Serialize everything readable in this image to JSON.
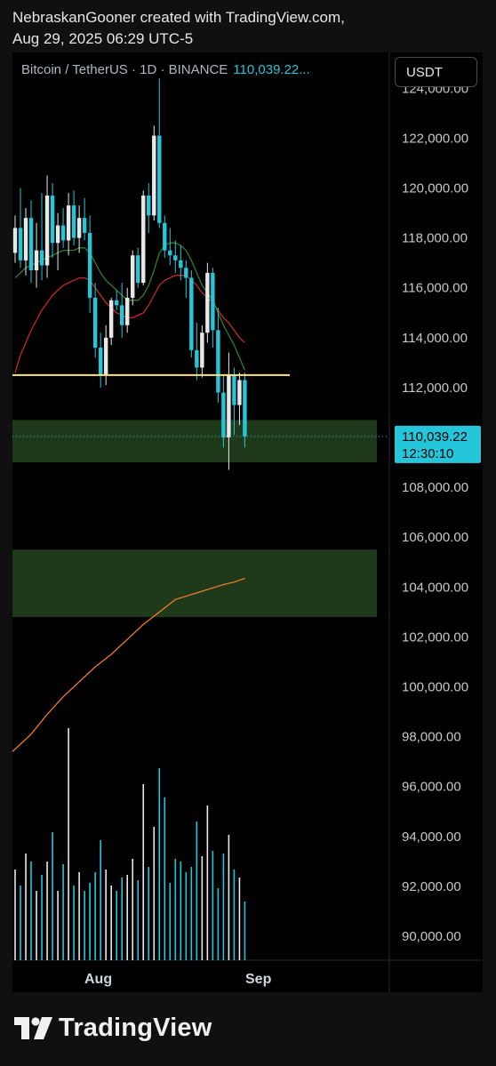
{
  "header": {
    "line1": "NebraskanGooner created with TradingView.com,",
    "line2": "Aug 29, 2025 06:29 UTC-5"
  },
  "legend": {
    "symbol": "Bitcoin / TetherUS · 1D · BINANCE",
    "price": "110,039.22..."
  },
  "currency_button": "USDT",
  "price_tag": {
    "price": "110,039.22",
    "countdown": "12:30:10"
  },
  "footer": {
    "brand": "TradingView"
  },
  "colors": {
    "up": "#e8e8e8",
    "down": "#26c6da",
    "ma_short": "#2e7d32",
    "ma_mid": "#c62828",
    "ma_long": "#ef7a28",
    "support_line": "#ffe47a",
    "zone": "#1f3a1b",
    "accent": "#26c6da"
  },
  "chart_data": {
    "type": "candlestick",
    "y_axis": {
      "ticks": [
        "122,000.00",
        "120,000.00",
        "118,000.00",
        "116,000.00",
        "114,000.00",
        "112,000.00",
        "108,000.00",
        "106,000.00",
        "104,000.00",
        "102,000.00",
        "100,000.00",
        "98,000.00",
        "96,000.00",
        "94,000.00",
        "92,000.00",
        "90,000.00"
      ],
      "partial_top_tick": "124,000.00",
      "range": [
        89200,
        124500
      ]
    },
    "x_axis": {
      "labels": [
        "Aug",
        "Sep"
      ]
    },
    "last_price": 110039.22,
    "support_line": 112500,
    "zones": [
      {
        "low": 109000,
        "high": 110700
      },
      {
        "low": 102800,
        "high": 105500
      }
    ],
    "candles": [
      {
        "o": 117400,
        "h": 118900,
        "l": 117000,
        "c": 118400
      },
      {
        "o": 118400,
        "h": 120000,
        "l": 116800,
        "c": 117100
      },
      {
        "o": 117100,
        "h": 119200,
        "l": 116500,
        "c": 118800
      },
      {
        "o": 118800,
        "h": 119500,
        "l": 116200,
        "c": 116700
      },
      {
        "o": 116700,
        "h": 118600,
        "l": 116000,
        "c": 117500
      },
      {
        "o": 117500,
        "h": 119800,
        "l": 116300,
        "c": 116900
      },
      {
        "o": 116900,
        "h": 120500,
        "l": 116400,
        "c": 119700
      },
      {
        "o": 119700,
        "h": 120200,
        "l": 117200,
        "c": 117800
      },
      {
        "o": 117800,
        "h": 119000,
        "l": 116700,
        "c": 118500
      },
      {
        "o": 118500,
        "h": 119200,
        "l": 117600,
        "c": 117900
      },
      {
        "o": 117900,
        "h": 119800,
        "l": 117300,
        "c": 119300
      },
      {
        "o": 119300,
        "h": 119900,
        "l": 117700,
        "c": 118000
      },
      {
        "o": 118000,
        "h": 119300,
        "l": 117400,
        "c": 118800
      },
      {
        "o": 118800,
        "h": 119600,
        "l": 117900,
        "c": 118200
      },
      {
        "o": 118200,
        "h": 118900,
        "l": 115000,
        "c": 115600
      },
      {
        "o": 115600,
        "h": 116200,
        "l": 113200,
        "c": 113600
      },
      {
        "o": 113600,
        "h": 114200,
        "l": 112000,
        "c": 112500
      },
      {
        "o": 112500,
        "h": 114500,
        "l": 112100,
        "c": 114000
      },
      {
        "o": 114000,
        "h": 115600,
        "l": 113700,
        "c": 115500
      },
      {
        "o": 115500,
        "h": 115900,
        "l": 115100,
        "c": 115300
      },
      {
        "o": 115300,
        "h": 116200,
        "l": 114000,
        "c": 114500
      },
      {
        "o": 114500,
        "h": 116000,
        "l": 114200,
        "c": 115600
      },
      {
        "o": 115600,
        "h": 117500,
        "l": 115300,
        "c": 117300
      },
      {
        "o": 117300,
        "h": 117600,
        "l": 116000,
        "c": 116200
      },
      {
        "o": 116200,
        "h": 119900,
        "l": 116100,
        "c": 119700
      },
      {
        "o": 119700,
        "h": 120200,
        "l": 118200,
        "c": 118900
      },
      {
        "o": 118900,
        "h": 122500,
        "l": 118700,
        "c": 122100
      },
      {
        "o": 122100,
        "h": 124400,
        "l": 118400,
        "c": 118600
      },
      {
        "o": 118600,
        "h": 118900,
        "l": 117200,
        "c": 117500
      },
      {
        "o": 117500,
        "h": 118400,
        "l": 116900,
        "c": 117300
      },
      {
        "o": 117300,
        "h": 117900,
        "l": 116600,
        "c": 117100
      },
      {
        "o": 117100,
        "h": 117700,
        "l": 116300,
        "c": 116800
      },
      {
        "o": 116800,
        "h": 117100,
        "l": 115600,
        "c": 116400
      },
      {
        "o": 116400,
        "h": 116700,
        "l": 113200,
        "c": 113500
      },
      {
        "o": 113500,
        "h": 114600,
        "l": 112300,
        "c": 112800
      },
      {
        "o": 112800,
        "h": 114500,
        "l": 112400,
        "c": 114200
      },
      {
        "o": 114200,
        "h": 117000,
        "l": 113800,
        "c": 116600
      },
      {
        "o": 116600,
        "h": 116800,
        "l": 113600,
        "c": 114300
      },
      {
        "o": 114300,
        "h": 115200,
        "l": 111400,
        "c": 111800
      },
      {
        "o": 111800,
        "h": 112500,
        "l": 109600,
        "c": 110000
      },
      {
        "o": 110000,
        "h": 113400,
        "l": 108700,
        "c": 112500
      },
      {
        "o": 112500,
        "h": 112800,
        "l": 110100,
        "c": 111300
      },
      {
        "o": 111300,
        "h": 112600,
        "l": 110500,
        "c": 112300
      },
      {
        "o": 112300,
        "h": 112600,
        "l": 109600,
        "c": 110039
      }
    ],
    "ma_short": [
      116400,
      116600,
      116800,
      116900,
      117000,
      117100,
      117200,
      117300,
      117400,
      117500,
      117500,
      117500,
      117600,
      117600,
      117400,
      117000,
      116600,
      116300,
      116100,
      115900,
      115700,
      115500,
      115500,
      115500,
      115700,
      116100,
      116700,
      117400,
      117700,
      117800,
      117800,
      117700,
      117500,
      117100,
      116600,
      116100,
      115800,
      115500,
      115000,
      114500,
      114100,
      113700,
      113200,
      112700
    ],
    "ma_mid": [
      112600,
      113300,
      113800,
      114300,
      114700,
      115100,
      115400,
      115700,
      115900,
      116100,
      116200,
      116300,
      116400,
      116400,
      116300,
      116000,
      115700,
      115400,
      115200,
      115000,
      114900,
      114800,
      114800,
      114900,
      115000,
      115300,
      115700,
      116100,
      116300,
      116400,
      116500,
      116500,
      116500,
      116300,
      116100,
      115800,
      115600,
      115400,
      115100,
      114800,
      114600,
      114300,
      114000,
      113800
    ],
    "ma_long_points": [
      [
        0,
        97400
      ],
      [
        3,
        98100
      ],
      [
        6,
        98900
      ],
      [
        9,
        99600
      ],
      [
        12,
        100200
      ],
      [
        15,
        100800
      ],
      [
        18,
        101300
      ],
      [
        21,
        101900
      ],
      [
        24,
        102500
      ],
      [
        27,
        103000
      ],
      [
        30,
        103500
      ],
      [
        33,
        103700
      ],
      [
        36,
        103900
      ],
      [
        39,
        104100
      ],
      [
        41,
        104200
      ],
      [
        43,
        104350
      ]
    ],
    "volume": [
      0.34,
      0.28,
      0.4,
      0.37,
      0.26,
      0.32,
      0.37,
      0.48,
      0.26,
      0.36,
      0.87,
      0.28,
      0.33,
      0.26,
      0.29,
      0.33,
      0.45,
      0.34,
      0.28,
      0.26,
      0.31,
      0.32,
      0.38,
      0.3,
      0.66,
      0.35,
      0.5,
      0.72,
      0.61,
      0.29,
      0.38,
      0.37,
      0.33,
      0.35,
      0.52,
      0.39,
      0.58,
      0.41,
      0.27,
      0.4,
      0.47,
      0.34,
      0.31,
      0.22
    ]
  }
}
